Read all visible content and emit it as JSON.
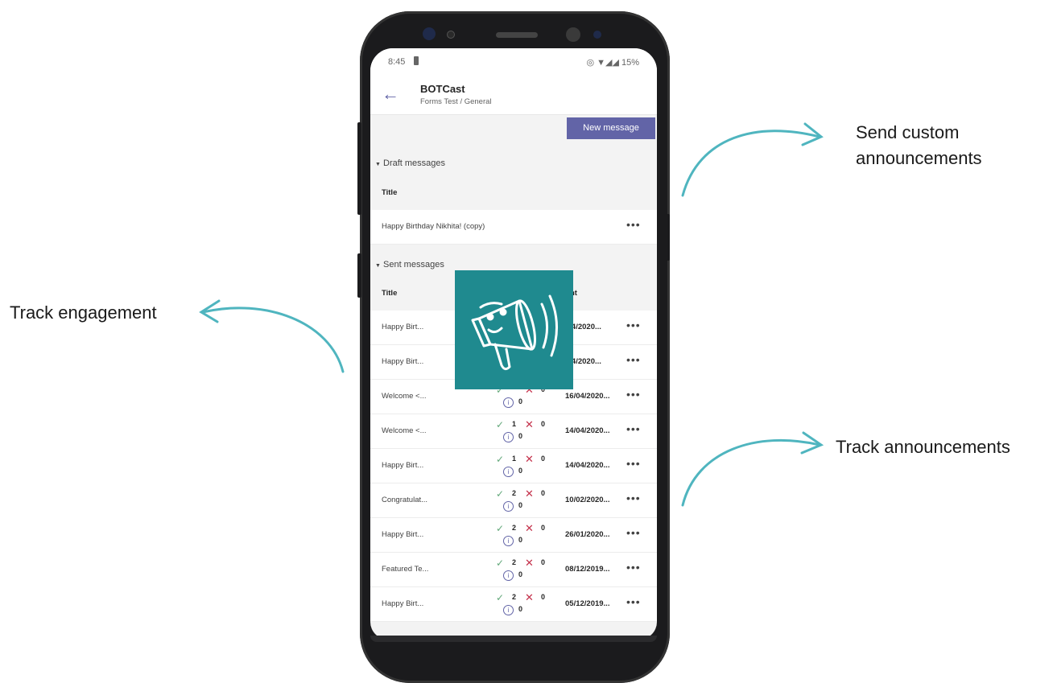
{
  "callouts": {
    "send_custom": "Send custom announcements",
    "track_engagement": "Track engagement",
    "track_announcements": "Track announcements"
  },
  "accent_color": "#4fb5bf",
  "status_bar": {
    "time": "8:45",
    "battery": "15%"
  },
  "app": {
    "title": "BOTCast",
    "subtitle": "Forms Test / General",
    "back_icon": "back-arrow-icon"
  },
  "new_message_button": "New message",
  "drafts": {
    "section_label": "Draft messages",
    "column_title": "Title",
    "rows": [
      {
        "title": "Happy Birthday Nikhita! (copy)",
        "more": "•••"
      }
    ]
  },
  "sent": {
    "section_label": "Sent messages",
    "column_title": "Title",
    "column_date": "nt",
    "rows": [
      {
        "title": "Happy Birt...",
        "date": "/04/2020...",
        "more": "•••"
      },
      {
        "title": "Happy Birt...",
        "date": "/04/2020...",
        "more": "•••"
      },
      {
        "title": "Welcome <...",
        "ok": "",
        "bad": "0",
        "info": "0",
        "date": "16/04/2020...",
        "more": "•••"
      },
      {
        "title": "Welcome <...",
        "ok": "1",
        "bad": "0",
        "info": "0",
        "date": "14/04/2020...",
        "more": "•••"
      },
      {
        "title": "Happy Birt...",
        "ok": "1",
        "bad": "0",
        "info": "0",
        "date": "14/04/2020...",
        "more": "•••"
      },
      {
        "title": "Congratulat...",
        "ok": "2",
        "bad": "0",
        "info": "0",
        "date": "10/02/2020...",
        "more": "•••"
      },
      {
        "title": "Happy Birt...",
        "ok": "2",
        "bad": "0",
        "info": "0",
        "date": "26/01/2020...",
        "more": "•••"
      },
      {
        "title": "Featured Te...",
        "ok": "2",
        "bad": "0",
        "info": "0",
        "date": "08/12/2019...",
        "more": "•••"
      },
      {
        "title": "Happy Birt...",
        "ok": "2",
        "bad": "0",
        "info": "0",
        "date": "05/12/2019...",
        "more": "•••"
      }
    ]
  },
  "logo_icon": "megaphone-icon",
  "logo_color": "#1f8a8f"
}
